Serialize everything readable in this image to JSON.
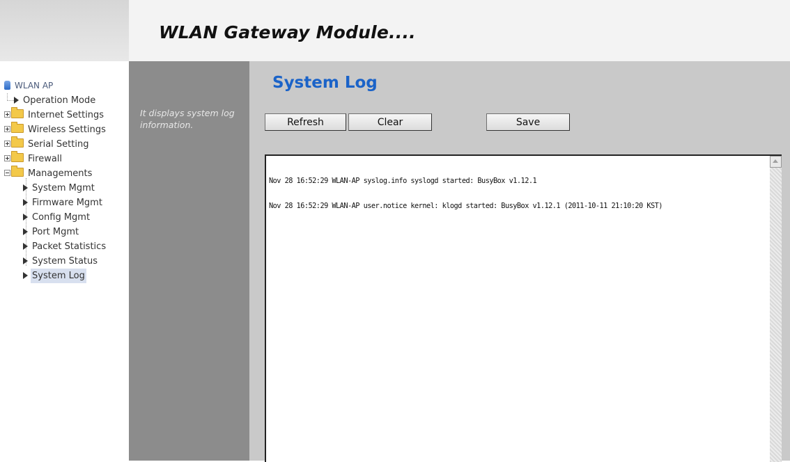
{
  "header": {
    "title": "WLAN Gateway Module...."
  },
  "sidebar": {
    "root": "WLAN AP",
    "items": [
      {
        "label": "Operation Mode"
      },
      {
        "label": "Internet Settings"
      },
      {
        "label": "Wireless Settings"
      },
      {
        "label": "Serial Setting"
      },
      {
        "label": "Firewall"
      },
      {
        "label": "Managements"
      }
    ],
    "managements": [
      {
        "label": "System Mgmt"
      },
      {
        "label": "Firmware Mgmt"
      },
      {
        "label": "Config Mgmt"
      },
      {
        "label": "Port Mgmt"
      },
      {
        "label": "Packet Statistics"
      },
      {
        "label": "System Status"
      },
      {
        "label": "System Log"
      }
    ],
    "selected": "System Log"
  },
  "description": "It displays system log information.",
  "main": {
    "title": "System Log",
    "buttons": {
      "refresh": "Refresh",
      "clear": "Clear",
      "save": "Save"
    },
    "log_lines": [
      "Nov 28 16:52:29 WLAN-AP syslog.info syslogd started: BusyBox v1.12.1",
      "Nov 28 16:52:29 WLAN-AP user.notice kernel: klogd started: BusyBox v1.12.1 (2011-10-11 21:10:20 KST)"
    ]
  },
  "colors": {
    "title_blue": "#1b63c8",
    "desc_panel": "#8c8c8c",
    "main_panel": "#c9c9c9"
  }
}
